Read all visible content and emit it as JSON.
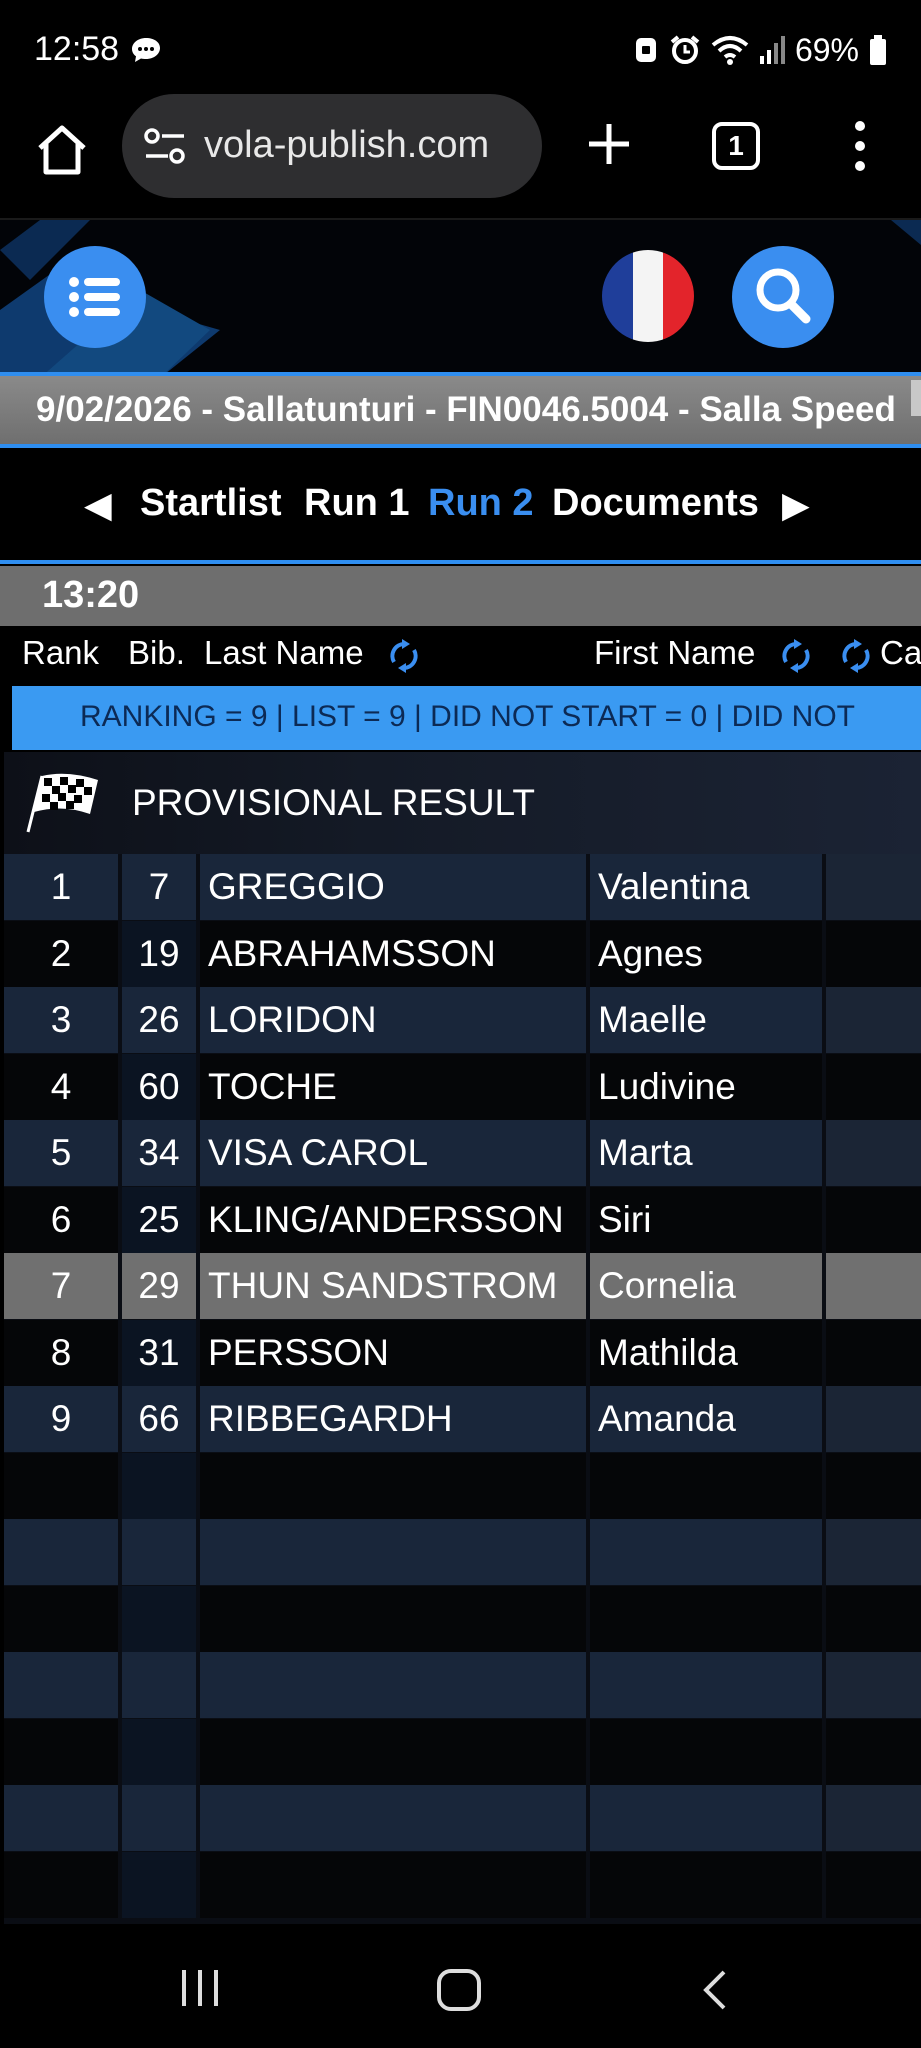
{
  "status_bar": {
    "time": "12:58",
    "battery": "69%"
  },
  "browser": {
    "url": "vola-publish.com",
    "tab_count": "1"
  },
  "event": {
    "title": "9/02/2026 - Sallatunturi - FIN0046.5004 - Salla Speed"
  },
  "nav": {
    "items": [
      {
        "label": "Startlist"
      },
      {
        "label": "Run 1"
      },
      {
        "label": "Run 2"
      },
      {
        "label": "Documents"
      }
    ],
    "active": "Run 2"
  },
  "time_label": "13:20",
  "columns": {
    "rank": "Rank",
    "bib": "Bib.",
    "last_name": "Last Name",
    "first_name": "First Name",
    "category_partial": "Ca"
  },
  "stats": "RANKING = 9  |  LIST = 9  |  DID NOT START = 0  |  DID NOT",
  "provisional_label": "PROVISIONAL RESULT",
  "results": [
    {
      "rank": "1",
      "bib": "7",
      "last": "GREGGIO",
      "first": "Valentina"
    },
    {
      "rank": "2",
      "bib": "19",
      "last": "ABRAHAMSSON",
      "first": "Agnes"
    },
    {
      "rank": "3",
      "bib": "26",
      "last": "LORIDON",
      "first": "Maelle"
    },
    {
      "rank": "4",
      "bib": "60",
      "last": "TOCHE",
      "first": "Ludivine"
    },
    {
      "rank": "5",
      "bib": "34",
      "last": "VISA CAROL",
      "first": "Marta"
    },
    {
      "rank": "6",
      "bib": "25",
      "last": "KLING/ANDERSSON",
      "first": "Siri"
    },
    {
      "rank": "7",
      "bib": "29",
      "last": "THUN SANDSTROM",
      "first": "Cornelia"
    },
    {
      "rank": "8",
      "bib": "31",
      "last": "PERSSON",
      "first": "Mathilda"
    },
    {
      "rank": "9",
      "bib": "66",
      "last": "RIBBEGARDH",
      "first": "Amanda"
    }
  ],
  "colors": {
    "accent": "#3a8ef0",
    "highlight_row": "#707070"
  }
}
